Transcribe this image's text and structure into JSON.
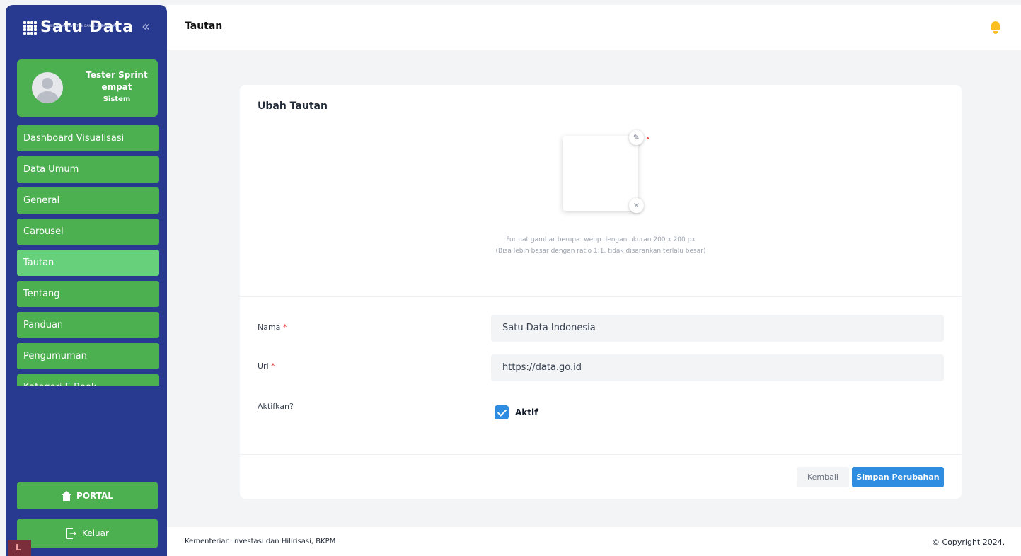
{
  "app": {
    "logo_text": "Satu Data",
    "logo_subtitle": "KEMENTERIAN INVESTASI DAN HILIRISASI/BKPM",
    "collapse_icon": "double-chevron-left-icon"
  },
  "user": {
    "name": "Tester Sprint empat",
    "role": "Sistem"
  },
  "sidebar": {
    "items": [
      {
        "label": "Dashboard Visualisasi"
      },
      {
        "label": "Data Umum"
      },
      {
        "label": "General"
      },
      {
        "label": "Carousel"
      },
      {
        "label": "Tautan",
        "active": true
      },
      {
        "label": "Tentang"
      },
      {
        "label": "Panduan"
      },
      {
        "label": "Pengumuman"
      },
      {
        "label": "Kategori E-Book"
      }
    ],
    "portal_label": "PORTAL",
    "logout_label": "Keluar"
  },
  "topbar": {
    "title": "Tautan"
  },
  "form": {
    "title": "Ubah Tautan",
    "image_hint_1": "Format gambar berupa .webp dengan ukuran 200 x 200 px",
    "image_hint_2": "(Bisa lebih besar dengan ratio 1:1, tidak disarankan terlalu besar)",
    "nama_label": "Nama",
    "nama_value": "Satu Data Indonesia",
    "url_label": "Url",
    "url_value": "https://data.go.id",
    "aktif_label": "Aktifkan?",
    "aktif_checkbox_label": "Aktif",
    "aktif_checked": true,
    "required_mark": "*",
    "back_label": "Kembali",
    "save_label": "Simpan Perubahan"
  },
  "footer": {
    "left": "Kementerian Investasi dan Hilirisasi, BKPM",
    "right": "© Copyright 2024."
  },
  "colors": {
    "sidebar_bg": "#283a8f",
    "menu_green": "#4caf50",
    "menu_active": "#66d07a",
    "primary_button": "#2e8de0"
  }
}
